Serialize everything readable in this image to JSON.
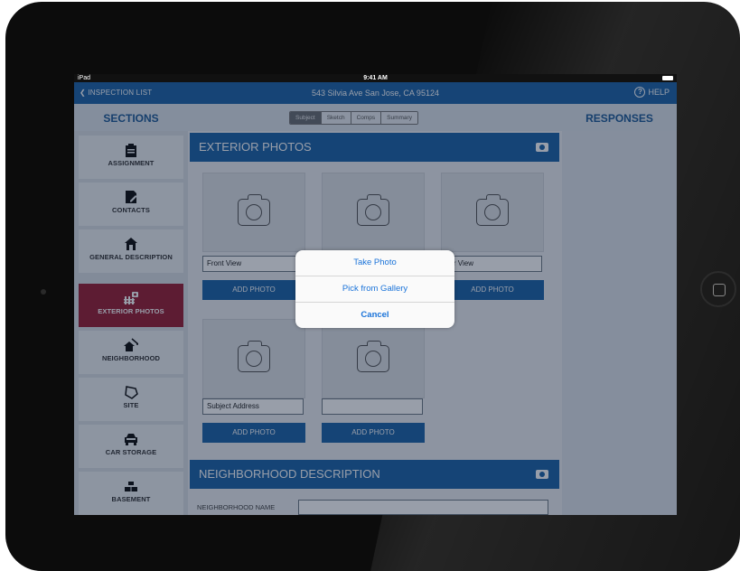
{
  "status_bar": {
    "device": "iPad",
    "time": "9:41 AM"
  },
  "nav": {
    "back_label": "INSPECTION LIST",
    "title": "543 Silvia Ave San Jose, CA 95124",
    "help_label": "HELP"
  },
  "headers": {
    "sections": "SECTIONS",
    "responses": "RESPONSES"
  },
  "tabs": [
    "Subject",
    "Sketch",
    "Comps",
    "Summary"
  ],
  "sidebar": {
    "items": [
      {
        "label": "ASSIGNMENT",
        "icon": "clipboard-icon"
      },
      {
        "label": "CONTACTS",
        "icon": "contact-card-icon"
      },
      {
        "label": "GENERAL DESCRIPTION",
        "icon": "house-icon"
      },
      {
        "label": "EXTERIOR PHOTOS",
        "icon": "fence-camera-icon",
        "active": true
      },
      {
        "label": "NEIGHBORHOOD",
        "icon": "neighborhood-icon"
      },
      {
        "label": "SITE",
        "icon": "site-plot-icon"
      },
      {
        "label": "CAR STORAGE",
        "icon": "car-icon"
      },
      {
        "label": "BASEMENT",
        "icon": "basement-icon"
      }
    ]
  },
  "exterior": {
    "title": "EXTERIOR PHOTOS",
    "photos": [
      {
        "caption": "Front View",
        "button": "ADD PHOTO"
      },
      {
        "caption": "",
        "button": "ADD PHOTO"
      },
      {
        "caption": "ear View",
        "button": "ADD PHOTO"
      },
      {
        "caption": "Subject Address",
        "button": "ADD PHOTO"
      },
      {
        "caption": "",
        "button": "ADD PHOTO"
      }
    ]
  },
  "neighborhood": {
    "title": "NEIGHBORHOOD DESCRIPTION",
    "name_label": "NEIGHBORHOOD NAME",
    "name_value": ""
  },
  "action_sheet": {
    "options": [
      "Take Photo",
      "Pick from Gallery",
      "Cancel"
    ]
  },
  "colors": {
    "nav_blue": "#1f65a8",
    "active_red": "#9a1f34",
    "link_blue": "#1a73d9"
  }
}
